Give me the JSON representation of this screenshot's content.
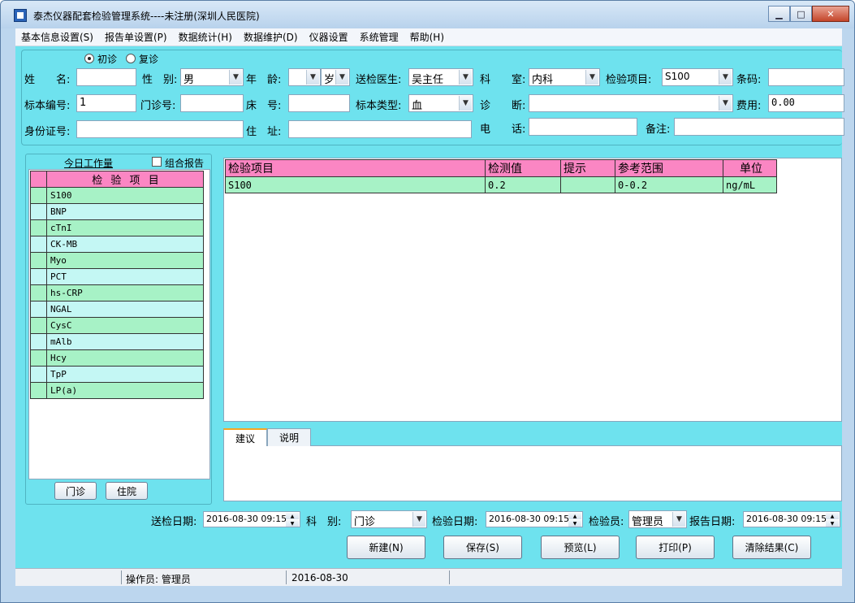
{
  "window": {
    "title": "泰杰仪器配套检验管理系统----未注册(深圳人民医院)"
  },
  "menu": [
    "基本信息设置(S)",
    "报告单设置(P)",
    "数据统计(H)",
    "数据维护(D)",
    "仪器设置",
    "系统管理",
    "帮助(H)"
  ],
  "visit_type": {
    "first": "初诊",
    "return": "复诊"
  },
  "form": {
    "name_label": "姓　　名:",
    "gender_label": "性　别:",
    "gender_value": "男",
    "age_label": "年　龄:",
    "age_unit": "岁",
    "doctor_label": "送检医生:",
    "doctor_value": "吴主任",
    "dept_label": "科　　室:",
    "dept_value": "内科",
    "item_label": "检验项目:",
    "item_value": "S100",
    "barcode_label": "条码:",
    "sample_no_label": "标本编号:",
    "sample_no_value": "1",
    "clinic_no_label": "门诊号:",
    "bed_label": "床　号:",
    "sample_type_label": "标本类型:",
    "sample_type_value": "血",
    "diagnosis_label": "诊　　断:",
    "fee_label": "费用:",
    "fee_value": "0.00",
    "id_label": "身份证号:",
    "address_label": "住　址:",
    "phone_label": "电　　话:",
    "remark_label": "备注:"
  },
  "worklist": {
    "title": "今日工作量",
    "combine_label": "组合报告",
    "header": "检 验 项 目",
    "items": [
      "S100",
      "BNP",
      "cTnI",
      "CK-MB",
      "Myo",
      "PCT",
      "hs-CRP",
      "NGAL",
      "CysC",
      "mAlb",
      "Hcy",
      "TpP",
      "LP(a)"
    ],
    "outpatient_btn": "门诊",
    "inpatient_btn": "住院"
  },
  "results": {
    "headers": [
      "检验项目",
      "检测值",
      "提示",
      "参考范围",
      "单位"
    ],
    "rows": [
      {
        "item": "S100",
        "value": "0.2",
        "hint": "",
        "range": "0-0.2",
        "unit": "ng/mL"
      }
    ]
  },
  "tabs": [
    "建议",
    "说明"
  ],
  "bottom": {
    "send_date_label": "送检日期:",
    "send_date_value": "2016-08-30 09:15",
    "dept_kind_label": "科　别:",
    "dept_kind_value": "门诊",
    "test_date_label": "检验日期:",
    "test_date_value": "2016-08-30 09:15",
    "tester_label": "检验员:",
    "tester_value": "管理员",
    "report_date_label": "报告日期:",
    "report_date_value": "2016-08-30 09:15"
  },
  "actions": [
    "新建(N)",
    "保存(S)",
    "预览(L)",
    "打印(P)",
    "清除结果(C)"
  ],
  "status": {
    "operator": "操作员: 管理员",
    "date": "2016-08-30"
  }
}
